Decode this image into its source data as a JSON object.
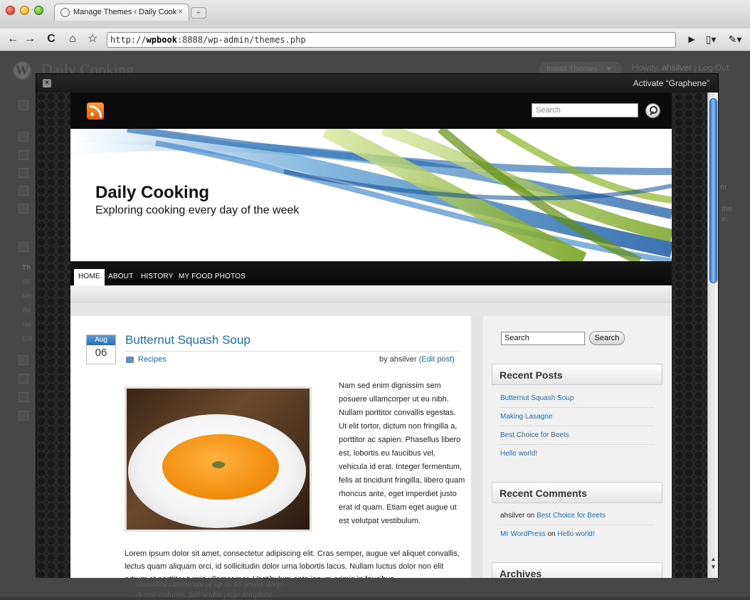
{
  "browser": {
    "tab_title": "Manage Themes ‹ Daily Cook",
    "tab_close": "×",
    "new_tab": "+",
    "url_prefix": "http://",
    "url_host": "wpbook",
    "url_rest": ":8888/wp-admin/themes.php"
  },
  "admin": {
    "site_title": "Daily Cooking",
    "install_button": "Install Themes",
    "install_caret": "▼",
    "howdy": "Howdy,",
    "user": "ahsilver",
    "logout": "| Log Out",
    "sidebar_labels": [
      "Th",
      "Wi",
      "Me",
      "Ba",
      "He",
      "Edi"
    ],
    "right_snippets": [
      "er",
      "the",
      "e"
    ],
    "bottom_lines": [
      "threaded comments of up to 10 levels deep!",
      "A one-column, full-width page template"
    ]
  },
  "modal": {
    "close": "×",
    "activate": "Activate “Graphene”"
  },
  "theme": {
    "top_search_placeholder": "Search",
    "site_title": "Daily Cooking",
    "site_description": "Exploring cooking every day of the week",
    "nav": [
      "HOME",
      "ABOUT",
      "HISTORY",
      "MY FOOD PHOTOS"
    ],
    "post": {
      "month": "Aug",
      "day": "06",
      "title": "Butternut Squash Soup",
      "category": "Recipes",
      "by": "by ahsilver",
      "edit": "(Edit post)",
      "text_wrap": "Nam sed enim dignissim sem posuere ullamcorper ut eu nibh. Nullam porttitor convallis egestas. Ut elit tortor, dictum non fringilla a, porttitor ac sapien. Phasellus libero est, lobortis eu faucibus vel, vehicula id erat. Integer fermentum, felis at tincidunt fringilla, libero quam rhoncus ante, eget imperdiet justo erat id quam. Etiam eget augue ut est volutpat vestibulum.",
      "text_full": "Lorem ipsum dolor sit amet, consectetur adipiscing elit. Cras semper, augue vel aliquet convallis, lectus quam aliquam orci, id sollicitudin dolor urna lobortis lacus. Nullam luctus dolor non elit rutrum et porttitor turpis ullamcorper. Vestibulum ante ipsum primis in faucibus"
    },
    "sidebar": {
      "search_value": "Search",
      "search_button": "Search",
      "recent_posts_title": "Recent Posts",
      "recent_posts": [
        "Butternut Squash Soup",
        "Making Lasagne",
        "Best Choice for Beets",
        "Hello world!"
      ],
      "recent_comments_title": "Recent Comments",
      "comments": [
        {
          "author": "ahsilver",
          "on": "on",
          "post": "Best Choice for Beets"
        },
        {
          "author": "Mr WordPress",
          "on": "on",
          "post": "Hello world!"
        }
      ],
      "archives_title": "Archives"
    }
  }
}
